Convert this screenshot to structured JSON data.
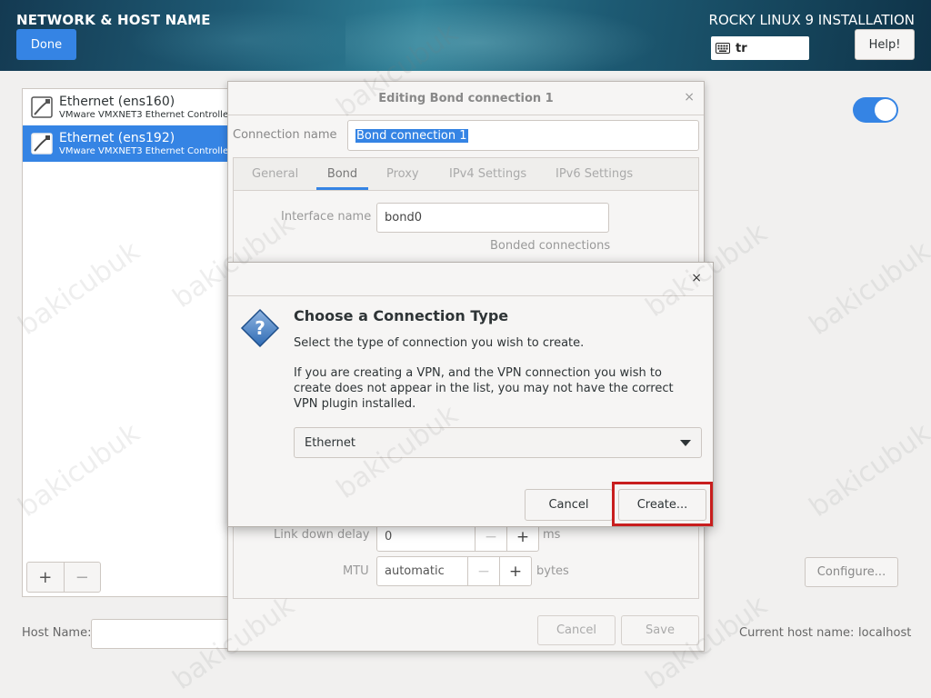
{
  "header": {
    "title": "NETWORK & HOST NAME",
    "done_label": "Done",
    "install_title": "ROCKY LINUX 9 INSTALLATION",
    "keyboard_layout": "tr",
    "help_label": "Help!"
  },
  "connections": [
    {
      "name": "Ethernet (ens160)",
      "desc": "VMware VMXNET3 Ethernet Controller",
      "selected": false
    },
    {
      "name": "Ethernet (ens192)",
      "desc": "VMware VMXNET3 Ethernet Controller",
      "selected": true
    }
  ],
  "list_toolbar": {
    "add": "+",
    "remove": "−"
  },
  "configure_label": "Configure...",
  "host": {
    "label": "Host Name:",
    "value": "",
    "current_label": "Current host name:",
    "current_value": "localhost"
  },
  "edit_dialog": {
    "title": "Editing Bond connection 1",
    "close": "×",
    "connection_name_label": "Connection name",
    "connection_name_value": "Bond connection 1",
    "tabs": [
      "General",
      "Bond",
      "Proxy",
      "IPv4 Settings",
      "IPv6 Settings"
    ],
    "active_tab": "Bond",
    "interface_name_label": "Interface name",
    "interface_name_value": "bond0",
    "bonded_connections_label": "Bonded connections",
    "link_down_delay_label": "Link down delay",
    "link_down_delay_value": "0",
    "link_down_delay_unit": "ms",
    "mtu_label": "MTU",
    "mtu_value": "automatic",
    "mtu_unit": "bytes",
    "cancel_label": "Cancel",
    "save_label": "Save"
  },
  "choose_dialog": {
    "close": "×",
    "heading": "Choose a Connection Type",
    "subtitle": "Select the type of connection you wish to create.",
    "info": "If you are creating a VPN, and the VPN connection you wish to create does not appear in the list, you may not have the correct VPN plugin installed.",
    "selected_type": "Ethernet",
    "cancel_label": "Cancel",
    "create_label": "Create..."
  },
  "watermark": "bakicubuk",
  "colors": {
    "accent": "#3584e4",
    "highlight": "#c81e1e"
  }
}
